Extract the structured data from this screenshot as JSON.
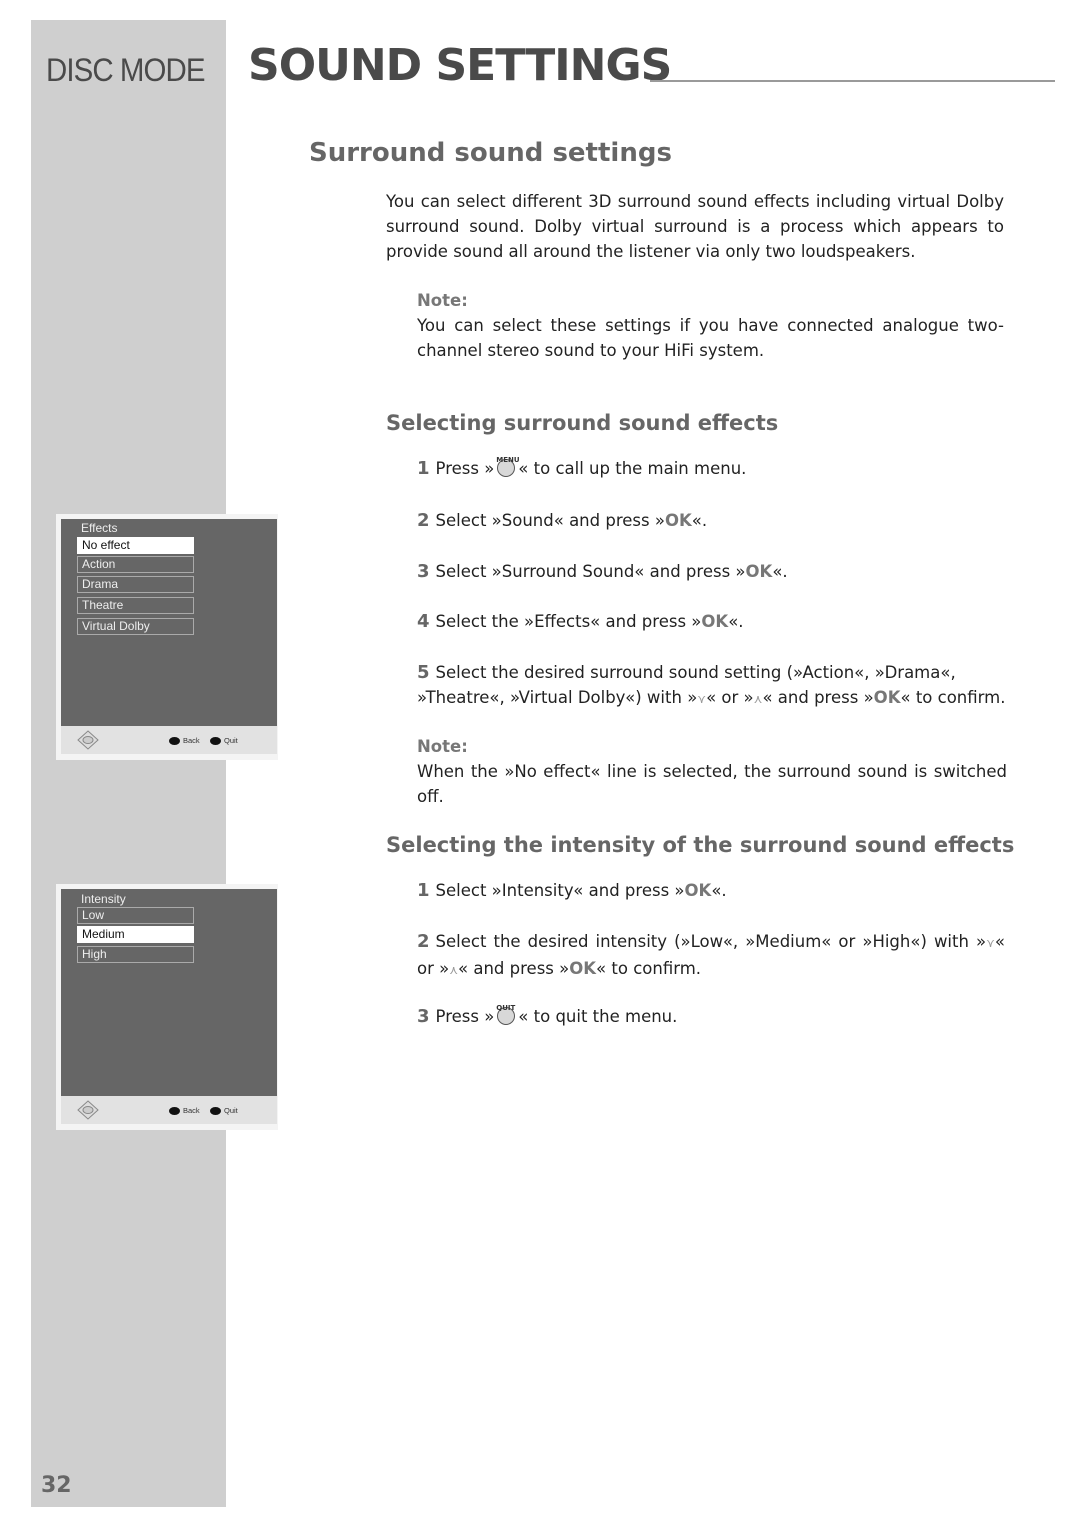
{
  "header": {
    "mode": "DISC MODE",
    "title": "SOUND SETTINGS"
  },
  "section": {
    "title": "Surround sound settings",
    "intro": "You can select different 3D surround sound effects including virtual Dolby surround sound. Dolby virtual surround is a process which appears to provide sound all around the listener via only two loudspeakers.",
    "note1_label": "Note:",
    "note1_text": "You can select these settings if you have connected analogue two-channel stereo sound to your HiFi system."
  },
  "effects": {
    "heading": "Selecting surround sound effects",
    "steps": [
      {
        "num": "1",
        "pre": "Press »",
        "button_caption": "MENU",
        "post": "« to call up the main menu."
      },
      {
        "num": "2",
        "pre": "Select »Sound« and press »",
        "ok": "OK",
        "post": "«."
      },
      {
        "num": "3",
        "pre": "Select »Surround Sound« and press »",
        "ok": "OK",
        "post": "«."
      },
      {
        "num": "4",
        "pre": "Select the »Effects« and press »",
        "ok": "OK",
        "post": "«."
      },
      {
        "num": "5",
        "pre": "Select the desired surround sound setting (»Action«, »Drama«, »Theatre«, »Virtual Dolby«) with »",
        "down": "⋎",
        "mid": "« or »",
        "up": "⋏",
        "mid2": "« and press »",
        "ok": "OK",
        "post": "« to confirm."
      }
    ],
    "note_label": "Note:",
    "note_text": "When the »No effect« line is selected, the surround sound is switched off."
  },
  "intensity": {
    "heading": "Selecting the intensity of the surround sound effects",
    "steps": [
      {
        "num": "1",
        "pre": "Select »Intensity« and press »",
        "ok": "OK",
        "post": "«."
      },
      {
        "num": "2",
        "pre": "Select the desired intensity (»Low«, »Medium« or »High«) with »",
        "down": "⋎",
        "mid": "« or »",
        "up": "⋏",
        "mid2": "« and press »",
        "ok": "OK",
        "post": "« to confirm."
      },
      {
        "num": "3",
        "pre": "Press »",
        "button_caption": "QUIT",
        "post": "« to quit the menu."
      }
    ]
  },
  "osd_effects": {
    "title": "Effects",
    "items": [
      "No effect",
      "Action",
      "Drama",
      "Theatre",
      "Virtual Dolby"
    ],
    "selected": "No effect",
    "back": "Back",
    "quit": "Quit"
  },
  "osd_intensity": {
    "title": "Intensity",
    "items": [
      "Low",
      "Medium",
      "High"
    ],
    "selected": "Medium",
    "back": "Back",
    "quit": "Quit"
  },
  "page_number": "32"
}
